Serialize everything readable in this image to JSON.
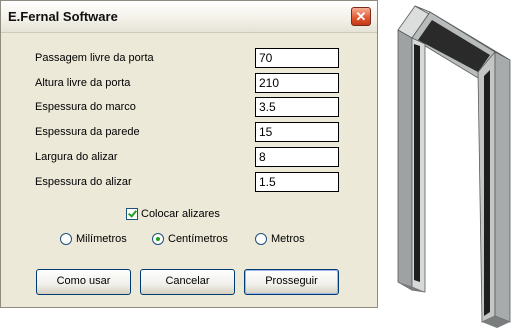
{
  "window": {
    "title": "E.Fernal Software",
    "close_label": "✕"
  },
  "fields": [
    {
      "label": "Passagem livre da porta",
      "value": "70"
    },
    {
      "label": "Altura livre da porta",
      "value": "210"
    },
    {
      "label": "Espessura do marco",
      "value": "3.5"
    },
    {
      "label": "Espessura da parede",
      "value": "15"
    },
    {
      "label": "Largura do alizar",
      "value": "8"
    },
    {
      "label": "Espessura do alizar",
      "value": "1.5"
    }
  ],
  "checkbox": {
    "label": "Colocar alizares",
    "checked": true
  },
  "units": [
    {
      "label": "Milímetros",
      "selected": false
    },
    {
      "label": "Centímetros",
      "selected": true
    },
    {
      "label": "Metros",
      "selected": false
    }
  ],
  "buttons": {
    "help": "Como usar",
    "cancel": "Cancelar",
    "proceed": "Prosseguir"
  },
  "colors": {
    "frame_light": "#c7c9c9",
    "frame_dark": "#1e1e1e",
    "frame_mid": "#8c8f8f",
    "accent_green": "#21a121"
  }
}
